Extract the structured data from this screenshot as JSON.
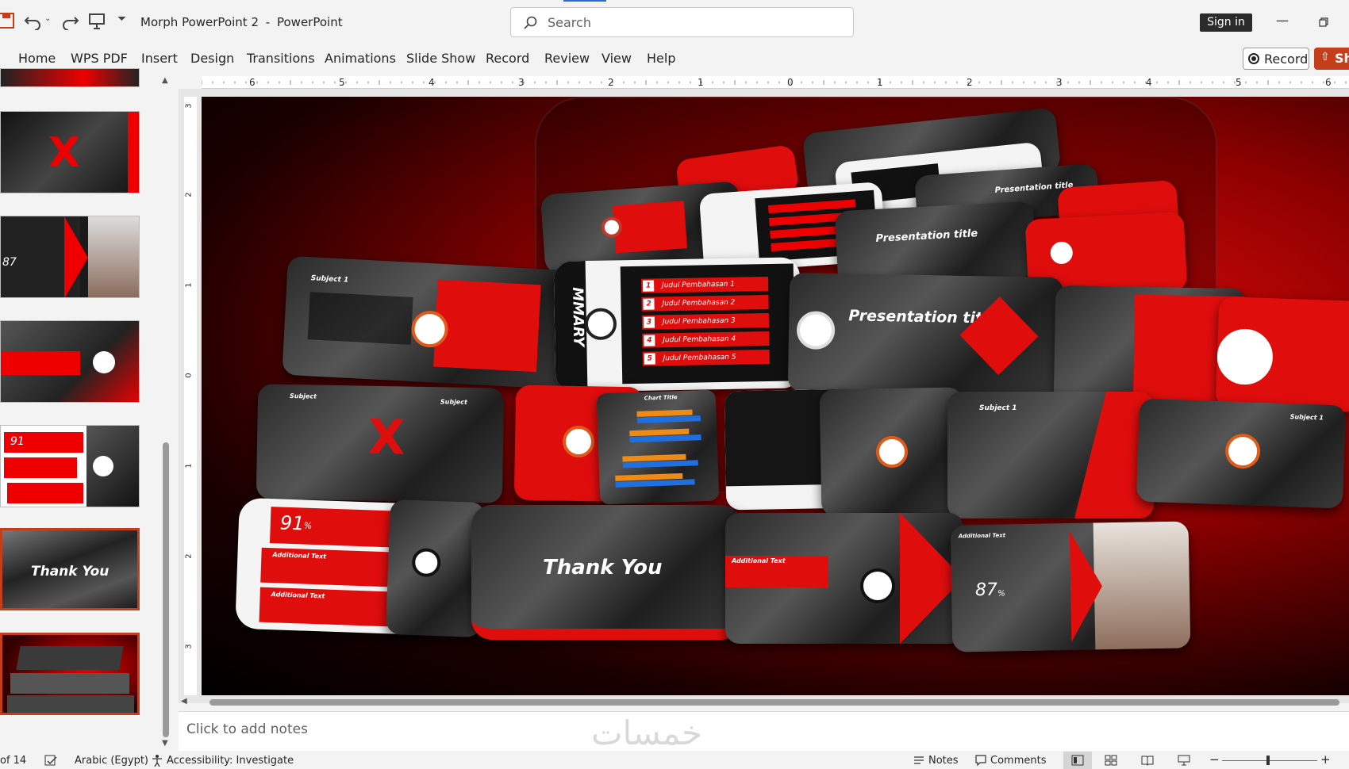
{
  "app": {
    "document_title": "Morph PowerPoint 2",
    "separator": "-",
    "app_name": "PowerPoint",
    "sign_in_label": "Sign in"
  },
  "search": {
    "placeholder": "Search"
  },
  "ribbon": {
    "tabs": [
      "Home",
      "WPS PDF",
      "Insert",
      "Design",
      "Transitions",
      "Animations",
      "Slide Show",
      "Record",
      "Review",
      "View",
      "Help"
    ],
    "record_label": "Record",
    "share_label": "Sh"
  },
  "ruler": {
    "top_ticks": [
      "6",
      "5",
      "4",
      "3",
      "2",
      "1",
      "0",
      "1",
      "2",
      "3",
      "4",
      "5",
      "6"
    ],
    "left_ticks": [
      "3",
      "2",
      "1",
      "0",
      "1",
      "2",
      "3"
    ]
  },
  "thumbnails": {
    "thank_you_text": "Thank You",
    "pct_91": "91",
    "pct_87": "87",
    "additional_text": "Additional Text"
  },
  "slide": {
    "presentation_title": "Presentation title",
    "thank_you": "Thank You",
    "pct_91": "91",
    "pct_87": "87",
    "pct_sign": "%",
    "subject_1": "Subject 1",
    "subject": "Subject",
    "additional_text": "Additional Text",
    "chart_title": "Chart Title",
    "agenda_items": [
      "Judul Pembahasan 1",
      "Judul Pembahasan 2",
      "Judul Pembahasan 3",
      "Judul Pembahasan 4",
      "Judul Pembahasan 5"
    ],
    "agenda_numbers": [
      "1",
      "2",
      "3",
      "4",
      "5"
    ],
    "big_letter": "X",
    "summary_text": "MMARY"
  },
  "notes": {
    "placeholder": "Click to add notes"
  },
  "status": {
    "slide_count": "of 14",
    "language": "Arabic (Egypt)",
    "accessibility": "Accessibility: Investigate",
    "notes_label": "Notes",
    "comments_label": "Comments",
    "zoom_minus": "−",
    "zoom_plus": "+"
  },
  "watermark": {
    "text": "خمسات"
  },
  "colors": {
    "accent": "#c43e1c",
    "slide_red": "#e00d0d",
    "dark": "#2b2b2b"
  }
}
